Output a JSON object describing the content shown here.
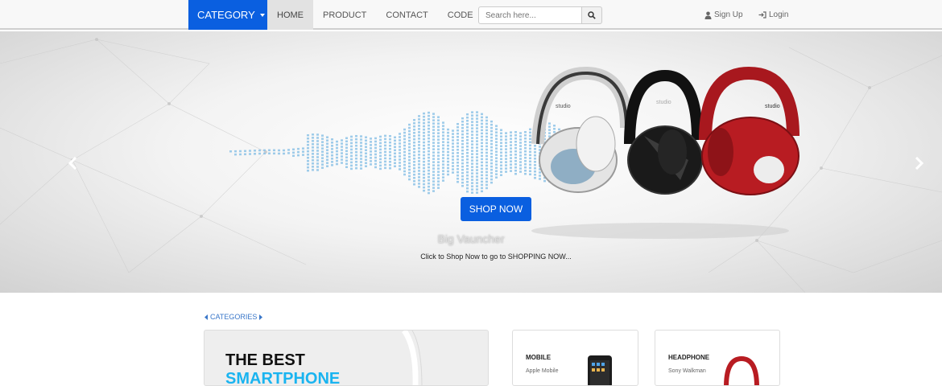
{
  "nav": {
    "category_label": "CATEGORY",
    "links": [
      "HOME",
      "PRODUCT",
      "CONTACT",
      "CODE"
    ],
    "active_link": "HOME",
    "search_placeholder": "Search here...",
    "signup_label": "Sign Up",
    "login_label": "Login"
  },
  "hero": {
    "button_label": "SHOP NOW",
    "title": "Big Vauncher",
    "subtitle": "Click to Shop Now to go to SHOPPING NOW...",
    "headphone_brand": "studio",
    "headphone_colors": [
      "#d8d8d8",
      "#1a1a1a",
      "#b81c22"
    ],
    "wave_color": "#8ec3e6"
  },
  "categories": {
    "heading": "CATEGORIES",
    "featured_line1": "THE BEST",
    "featured_line2": "SMARTPHONE",
    "items": [
      {
        "title": "MOBILE",
        "subtitle": "Apple Mobile"
      },
      {
        "title": "HEADPHONE",
        "subtitle": "Sony Walkman"
      }
    ]
  },
  "colors": {
    "accent": "#0a5fe0",
    "link": "#3a77c9"
  }
}
